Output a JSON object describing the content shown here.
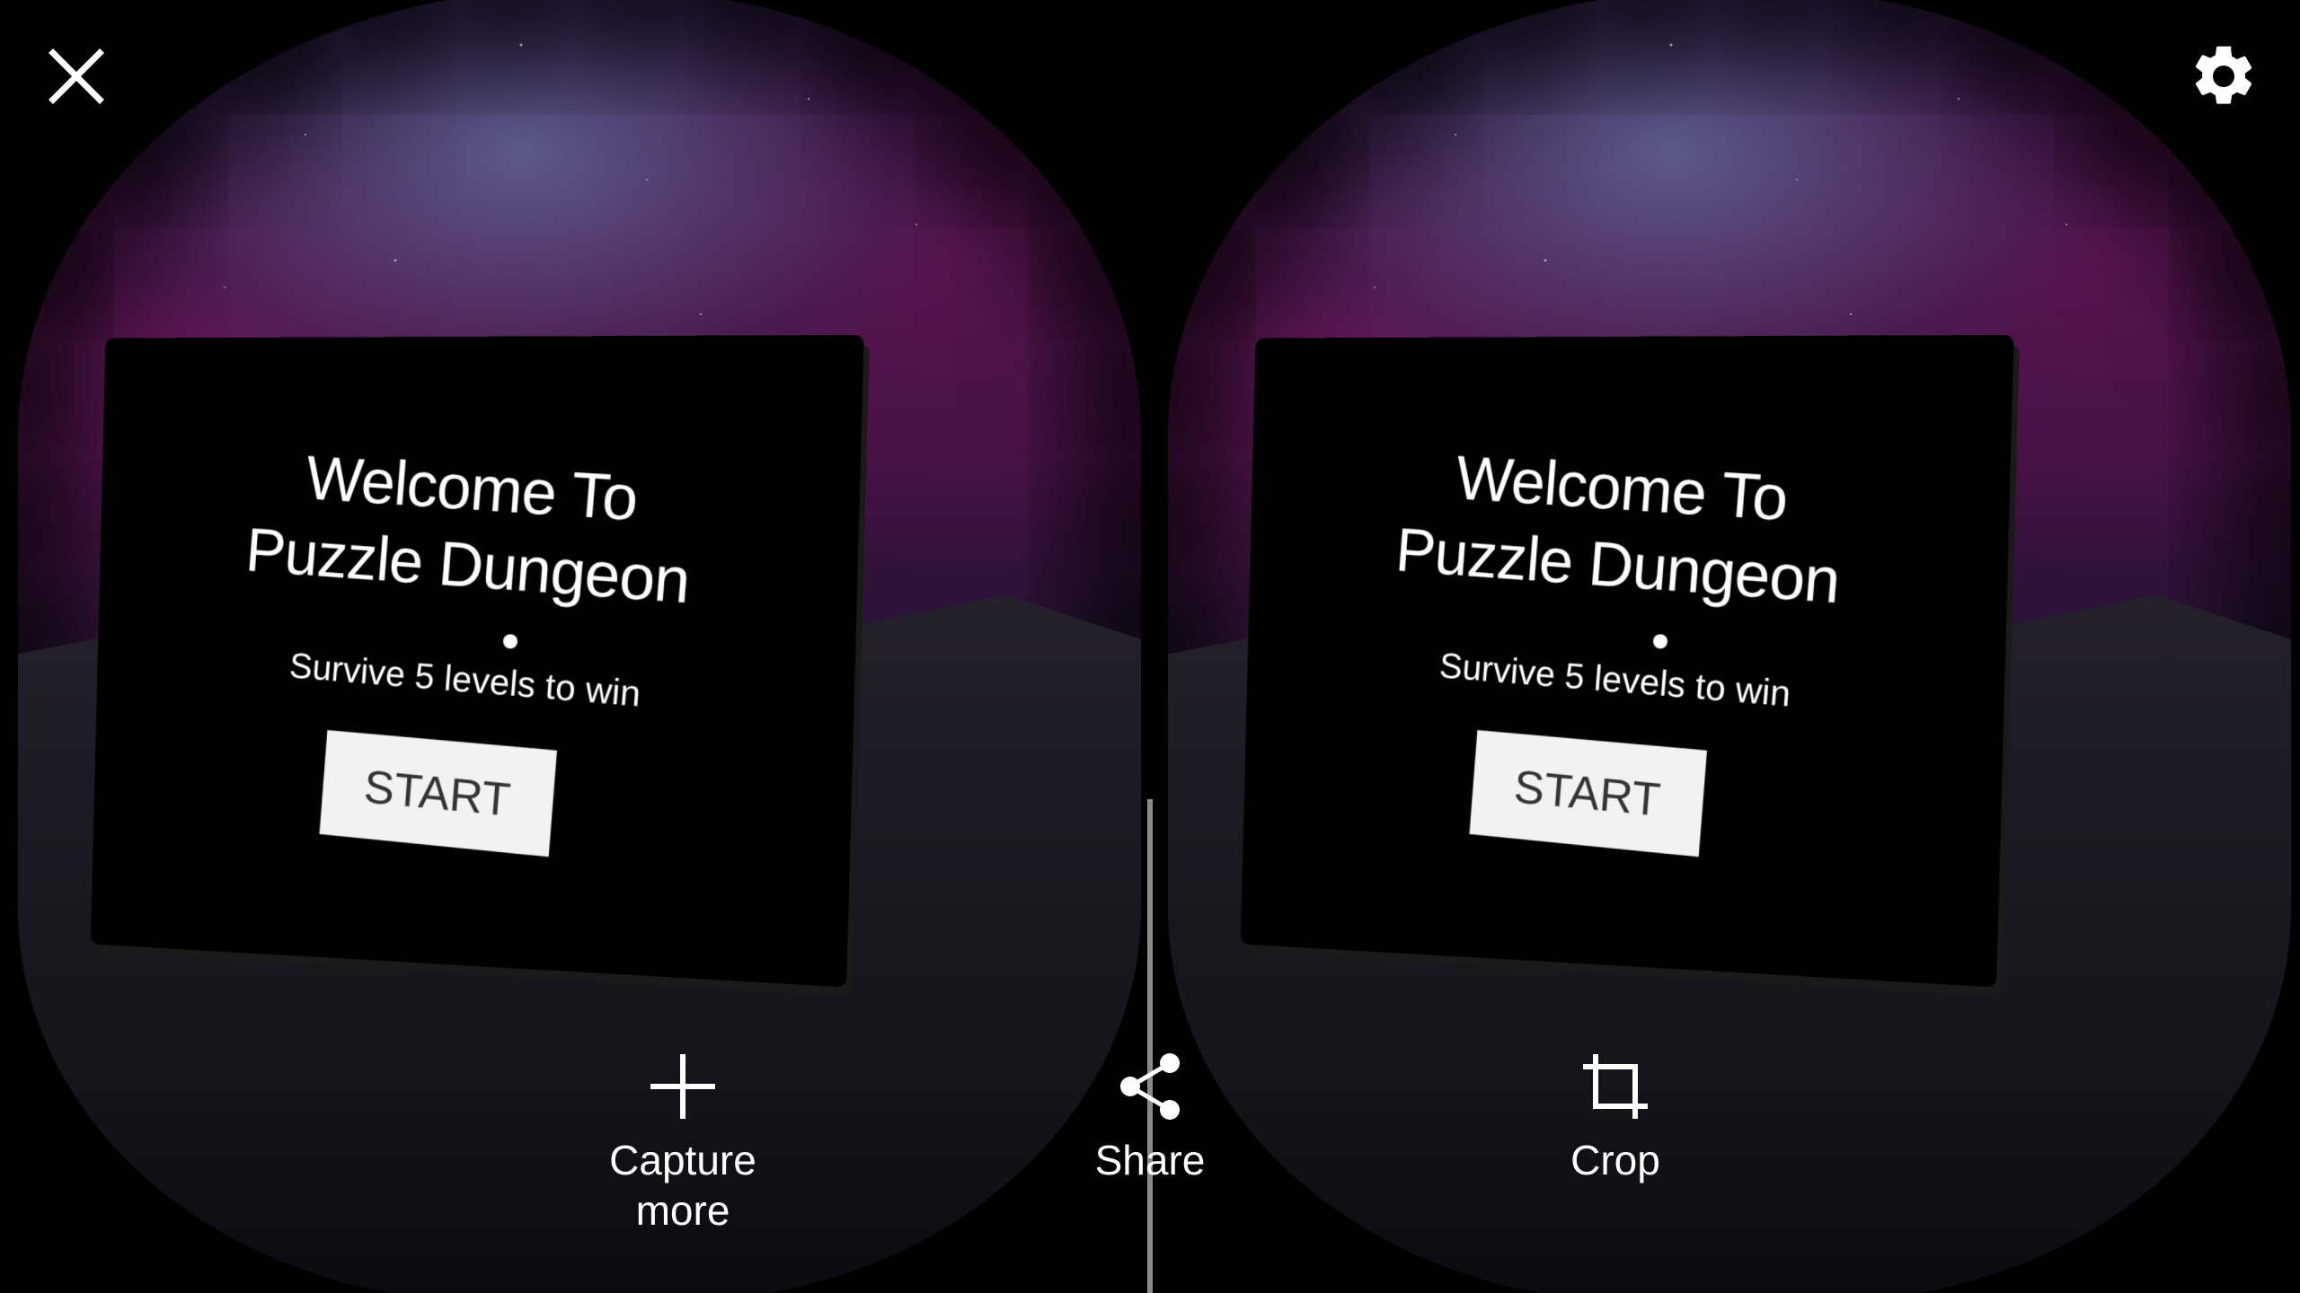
{
  "panel": {
    "title_line1": "Welcome To",
    "title_line2": "Puzzle Dungeon",
    "subtitle": "Survive 5 levels to win",
    "start_label": "START"
  },
  "toolbar": {
    "close_icon": "close-icon",
    "settings_icon": "gear-icon"
  },
  "actions": {
    "capture_label": "Capture\nmore",
    "share_label": "Share",
    "crop_label": "Crop"
  },
  "colors": {
    "sky": "#3c0f3e",
    "ground": "#1c1a24",
    "panel": "#000000",
    "start_button": "#f2f2f2"
  }
}
